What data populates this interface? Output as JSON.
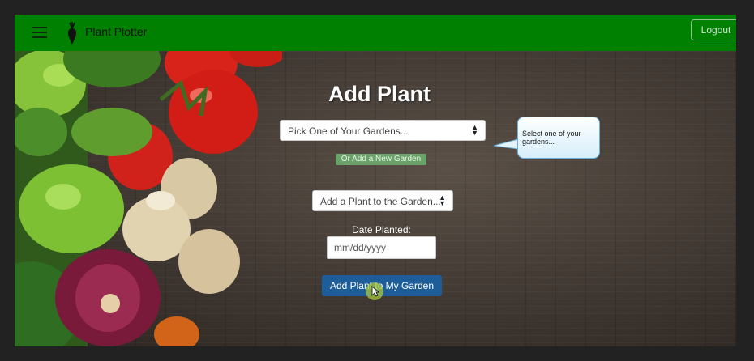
{
  "navbar": {
    "menu_icon": "hamburger-icon",
    "logo_icon": "carrot-icon",
    "brand": "Plant Plotter",
    "logout_label": "Logout",
    "color": "#008000"
  },
  "form": {
    "title": "Add Plant",
    "garden_select": {
      "selected": "Pick One of Your Gardens...",
      "icon": "select-arrows-icon"
    },
    "add_garden_label": "Or Add a New Garden",
    "plant_select": {
      "selected": "Add a Plant to the Garden...",
      "icon": "select-arrows-icon"
    },
    "date_label": "Date Planted:",
    "date_placeholder": "mm/dd/yyyy",
    "submit_label": "Add Plant to My Garden",
    "submit_color": "#1c5d9a"
  },
  "tooltip": {
    "text": "Select one of your gardens..."
  }
}
